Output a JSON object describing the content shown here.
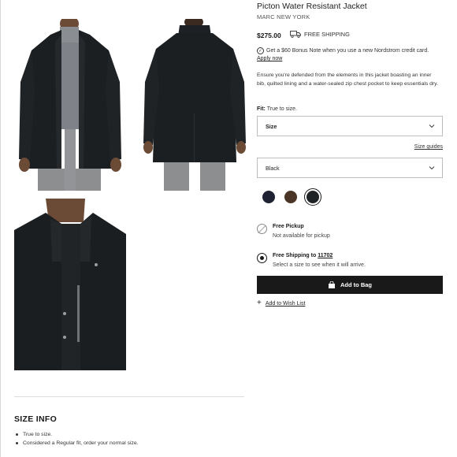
{
  "product": {
    "title": "Picton Water Resistant Jacket",
    "brand": "MARC NEW YORK",
    "price": "$275.00",
    "shipping_badge": "FREE SHIPPING",
    "bonus_note": "Get a $60 Bonus Note when you use a new Nordstrom credit card.",
    "apply_link": "Apply now",
    "description": "Ensure you're defended from the elements in this jacket boasting an inner bib, quilted lining and a water-sealed zip chest pocket to keep essentials dry.",
    "fit_label": "Fit:",
    "fit_value": "True to size."
  },
  "selectors": {
    "size_label": "Size",
    "size_guides": "Size guides",
    "color_value": "Black"
  },
  "swatches": [
    {
      "name": "navy",
      "color": "#1e2232"
    },
    {
      "name": "brown",
      "color": "#4a3526"
    },
    {
      "name": "black",
      "color": "#1f2224",
      "selected": true
    }
  ],
  "delivery": {
    "pickup_title": "Free Pickup",
    "pickup_sub": "Not available for pickup",
    "ship_title": "Free Shipping to",
    "ship_zip": "11702",
    "ship_sub": "Select a size to see when it will arrive."
  },
  "actions": {
    "add_to_bag": "Add to Bag",
    "wish_list": "Add to Wish List"
  },
  "size_info": {
    "heading": "SIZE INFO",
    "bullets": [
      "True to size.",
      "Considered a Regular fit, order your normal size."
    ]
  },
  "colors": {
    "accent": "#191919"
  }
}
